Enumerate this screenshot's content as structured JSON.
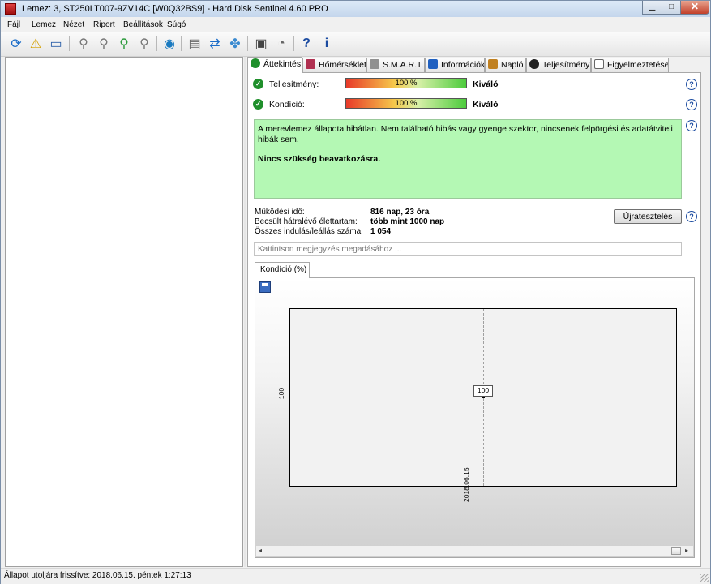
{
  "window": {
    "title": "Lemez: 3, ST250LT007-9ZV14C [W0Q32BS9]  -  Hard Disk Sentinel 4.60 PRO"
  },
  "menu": [
    "Fájl",
    "Lemez",
    "Nézet",
    "Riport",
    "Beállítások",
    "Súgó"
  ],
  "toolbar": [
    "refresh-icon",
    "warning-icon",
    "disk-icon",
    "satellite-icon",
    "satellite-icon",
    "satellite-icon",
    "satellite-icon",
    "globe-icon",
    "report-icon",
    "sync-icon",
    "puzzle-icon",
    "monitor-icon",
    "speaker-icon",
    "help-icon",
    "info-icon"
  ],
  "tabs": [
    {
      "label": "Áttekintés",
      "color": "#1f8f2b"
    },
    {
      "label": "Hőmérséklet",
      "color": "#b03050"
    },
    {
      "label": "S.M.A.R.T.",
      "color": "#707070"
    },
    {
      "label": "Információk",
      "color": "#2060c0"
    },
    {
      "label": "Napló",
      "color": "#c08020"
    },
    {
      "label": "Teljesítmény",
      "color": "#202020"
    },
    {
      "label": "Figyelmeztetések",
      "color": "#606060"
    }
  ],
  "performance": {
    "label": "Teljesítmény:",
    "bar_text": "100 %",
    "value": 100,
    "rating": "Kiváló"
  },
  "health": {
    "label": "Kondíció:",
    "bar_text": "100 %",
    "value": 100,
    "rating": "Kiváló"
  },
  "status_message": "A merevlemez állapota hibátlan. Nem található hibás vagy gyenge szektor, nincsenek felpörgési és adatátviteli hibák sem.",
  "status_action": "Nincs szükség beavatkozásra.",
  "info": {
    "uptime_label": "Működési idő:",
    "uptime_value": "816 nap, 23 óra",
    "lifetime_label": "Becsült hátralévő élettartam:",
    "lifetime_value": "több mint 1000 nap",
    "startstop_label": "Összes indulás/leállás száma:",
    "startstop_value": "1 054"
  },
  "retest_button": "Újratesztelés",
  "note_placeholder": "Kattintson megjegyzés megadásához ...",
  "chart_tab": "Kondíció  (%)",
  "chart_data": {
    "type": "line",
    "title": "Kondíció  (%)",
    "x": [
      "2018.06.15"
    ],
    "series": [
      {
        "values": [
          100
        ]
      }
    ],
    "xlabel": "",
    "ylabel": "",
    "y_tick_labels": [
      "100"
    ],
    "x_tick_labels": [
      "2018.06.15"
    ],
    "data_labels": [
      "100"
    ],
    "grid": true
  },
  "statusbar": "Állapot utoljára frissítve: 2018.06.15. péntek 1:27:13"
}
